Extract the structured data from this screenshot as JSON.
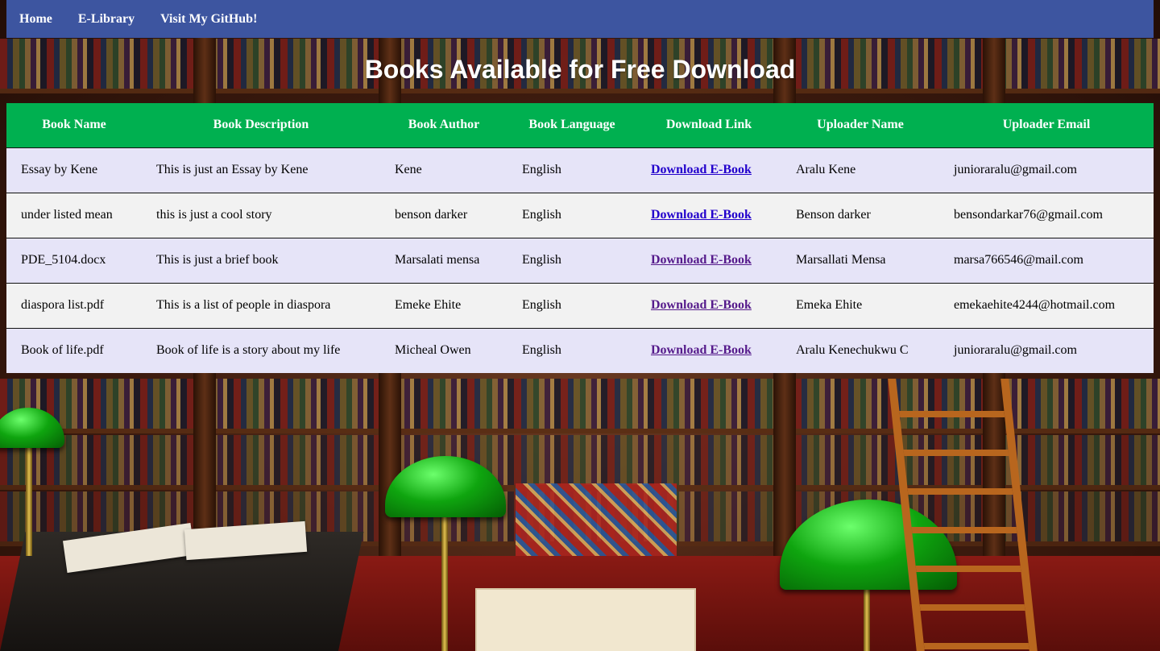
{
  "nav": {
    "items": [
      {
        "label": "Home"
      },
      {
        "label": "E-Library"
      },
      {
        "label": "Visit My GitHub!"
      }
    ]
  },
  "page": {
    "title": "Books Available for Free Download"
  },
  "table": {
    "headers": [
      "Book Name",
      "Book Description",
      "Book Author",
      "Book Language",
      "Download Link",
      "Uploader Name",
      "Uploader Email"
    ],
    "rows": [
      {
        "name": "Essay by Kene",
        "description": "This is just an Essay by Kene",
        "author": "Kene",
        "language": "English",
        "link": "Download E-Book",
        "uploader": "Aralu Kene",
        "email": "junioraralu@gmail.com",
        "link_state": "unvisited"
      },
      {
        "name": "under listed mean",
        "description": "this is just a cool story",
        "author": "benson darker",
        "language": "English",
        "link": "Download E-Book",
        "uploader": "Benson darker",
        "email": "bensondarkar76@gmail.com",
        "link_state": "unvisited"
      },
      {
        "name": "PDE_5104.docx",
        "description": "This is just a brief book",
        "author": "Marsalati mensa",
        "language": "English",
        "link": "Download E-Book",
        "uploader": "Marsallati Mensa",
        "email": "marsa766546@mail.com",
        "link_state": "visited"
      },
      {
        "name": "diaspora list.pdf",
        "description": "This is a list of people in diaspora",
        "author": "Emeke Ehite",
        "language": "English",
        "link": "Download E-Book",
        "uploader": "Emeka Ehite",
        "email": "emekaehite4244@hotmail.com",
        "link_state": "visited"
      },
      {
        "name": "Book of life.pdf",
        "description": "Book of life is a story about my life",
        "author": "Micheal Owen",
        "language": "English",
        "link": "Download E-Book",
        "uploader": "Aralu Kenechukwu C",
        "email": "junioraralu@gmail.com",
        "link_state": "visited"
      }
    ]
  },
  "colors": {
    "navbar": "#3d55a0",
    "table_header": "#00b050",
    "row_odd": "#e6e4f8",
    "row_even": "#f2f2f2",
    "link_unvisited": "#2200cc",
    "link_visited": "#551a8b"
  }
}
